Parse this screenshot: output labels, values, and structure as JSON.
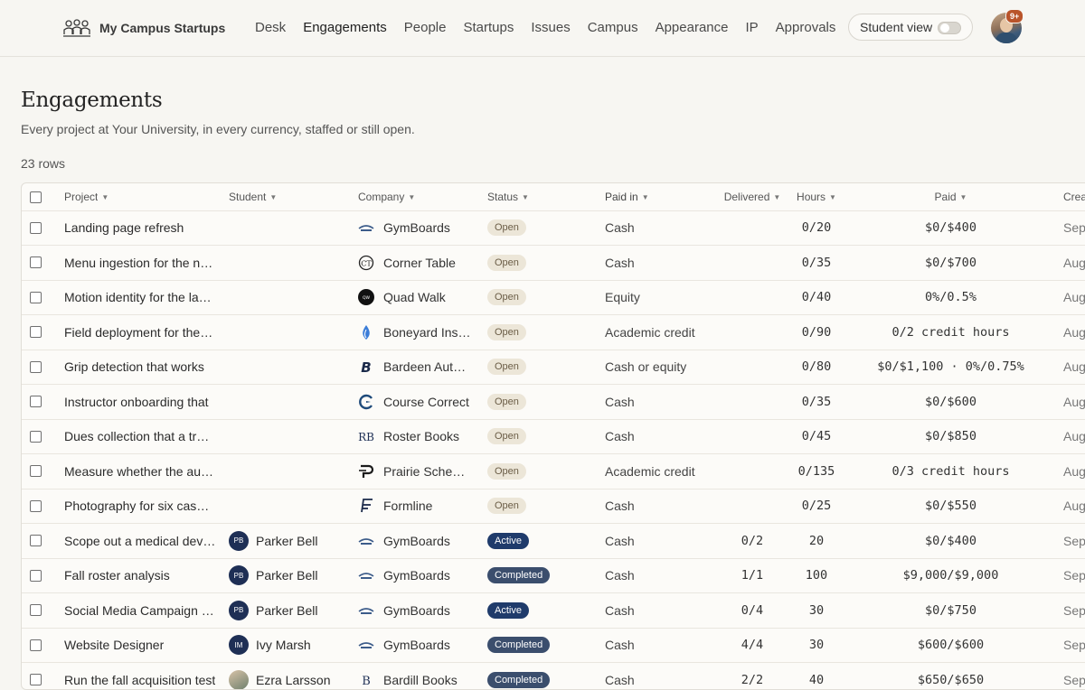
{
  "app": {
    "brand": "My Campus Startups"
  },
  "nav": {
    "items": [
      "Desk",
      "Engagements",
      "People",
      "Startups",
      "Issues",
      "Campus",
      "Appearance",
      "IP",
      "Approvals"
    ],
    "active": "Engagements",
    "student_view_label": "Student view",
    "student_view_on": false,
    "notification_badge": "9+"
  },
  "page": {
    "title": "Engagements",
    "subtitle": "Every project at Your University, in every currency, staffed or still open.",
    "row_count": "23 rows"
  },
  "table": {
    "headers": {
      "project": "Project",
      "student": "Student",
      "company": "Company",
      "status": "Status",
      "paid_in": "Paid in",
      "delivered": "Delivered",
      "hours": "Hours",
      "paid": "Paid",
      "created": "Crea"
    },
    "rows": [
      {
        "project": "Landing page refresh",
        "student": "",
        "initials": "",
        "company": "GymBoards",
        "logo": "gymboards-logo",
        "status": "Open",
        "paid_in": "Cash",
        "delivered": "",
        "hours": "0/20",
        "paid": "$0/$400",
        "created": "Sep"
      },
      {
        "project": "Menu ingestion for the new",
        "student": "",
        "initials": "",
        "company": "Corner Table",
        "logo": "corner-table-logo",
        "status": "Open",
        "paid_in": "Cash",
        "delivered": "",
        "hours": "0/35",
        "paid": "$0/$700",
        "created": "Aug"
      },
      {
        "project": "Motion identity for the launch",
        "student": "",
        "initials": "",
        "company": "Quad Walk",
        "logo": "quad-walk-logo",
        "status": "Open",
        "paid_in": "Equity",
        "delivered": "",
        "hours": "0/40",
        "paid": "0%/0.5%",
        "created": "Aug"
      },
      {
        "project": "Field deployment for the pilot",
        "student": "",
        "initials": "",
        "company": "Boneyard Instruments",
        "logo": "boneyard-logo",
        "status": "Open",
        "paid_in": "Academic credit",
        "delivered": "",
        "hours": "0/90",
        "paid": "0/2 credit hours",
        "created": "Aug"
      },
      {
        "project": "Grip detection that works",
        "student": "",
        "initials": "",
        "company": "Bardeen Automation",
        "logo": "bardeen-logo",
        "status": "Open",
        "paid_in": "Cash or equity",
        "delivered": "",
        "hours": "0/80",
        "paid": "$0/$1,100 · 0%/0.75%",
        "created": "Aug"
      },
      {
        "project": "Instructor onboarding that",
        "student": "",
        "initials": "",
        "company": "Course Correct",
        "logo": "course-correct-logo",
        "status": "Open",
        "paid_in": "Cash",
        "delivered": "",
        "hours": "0/35",
        "paid": "$0/$600",
        "created": "Aug"
      },
      {
        "project": "Dues collection that a treasurer",
        "student": "",
        "initials": "",
        "company": "Roster Books",
        "logo": "roster-books-logo",
        "status": "Open",
        "paid_in": "Cash",
        "delivered": "",
        "hours": "0/45",
        "paid": "$0/$850",
        "created": "Aug"
      },
      {
        "project": "Measure whether the automated",
        "student": "",
        "initials": "",
        "company": "Prairie Scheduling",
        "logo": "prairie-logo",
        "status": "Open",
        "paid_in": "Academic credit",
        "delivered": "",
        "hours": "0/135",
        "paid": "0/3 credit hours",
        "created": "Aug"
      },
      {
        "project": "Photography for six case studies",
        "student": "",
        "initials": "",
        "company": "Formline",
        "logo": "formline-logo",
        "status": "Open",
        "paid_in": "Cash",
        "delivered": "",
        "hours": "0/25",
        "paid": "$0/$550",
        "created": "Aug"
      },
      {
        "project": "Scope out a medical device",
        "student": "Parker Bell",
        "initials": "PB",
        "company": "GymBoards",
        "logo": "gymboards-logo",
        "status": "Active",
        "paid_in": "Cash",
        "delivered": "0/2",
        "hours": "20",
        "paid": "$0/$400",
        "created": "Sep"
      },
      {
        "project": "Fall roster analysis",
        "student": "Parker Bell",
        "initials": "PB",
        "company": "GymBoards",
        "logo": "gymboards-logo",
        "status": "Completed",
        "paid_in": "Cash",
        "delivered": "1/1",
        "hours": "100",
        "paid": "$9,000/$9,000",
        "created": "Sep"
      },
      {
        "project": "Social Media Campaign Plan",
        "student": "Parker Bell",
        "initials": "PB",
        "company": "GymBoards",
        "logo": "gymboards-logo",
        "status": "Active",
        "paid_in": "Cash",
        "delivered": "0/4",
        "hours": "30",
        "paid": "$0/$750",
        "created": "Sep"
      },
      {
        "project": "Website Designer",
        "student": "Ivy Marsh",
        "initials": "IM",
        "company": "GymBoards",
        "logo": "gymboards-logo",
        "status": "Completed",
        "paid_in": "Cash",
        "delivered": "4/4",
        "hours": "30",
        "paid": "$600/$600",
        "created": "Sep"
      },
      {
        "project": "Run the fall acquisition test",
        "student": "Ezra Larsson",
        "initials": "",
        "company": "Bardill Books",
        "logo": "bardill-logo",
        "status": "Completed",
        "paid_in": "Cash",
        "delivered": "2/2",
        "hours": "40",
        "paid": "$650/$650",
        "created": "Sep"
      }
    ]
  }
}
